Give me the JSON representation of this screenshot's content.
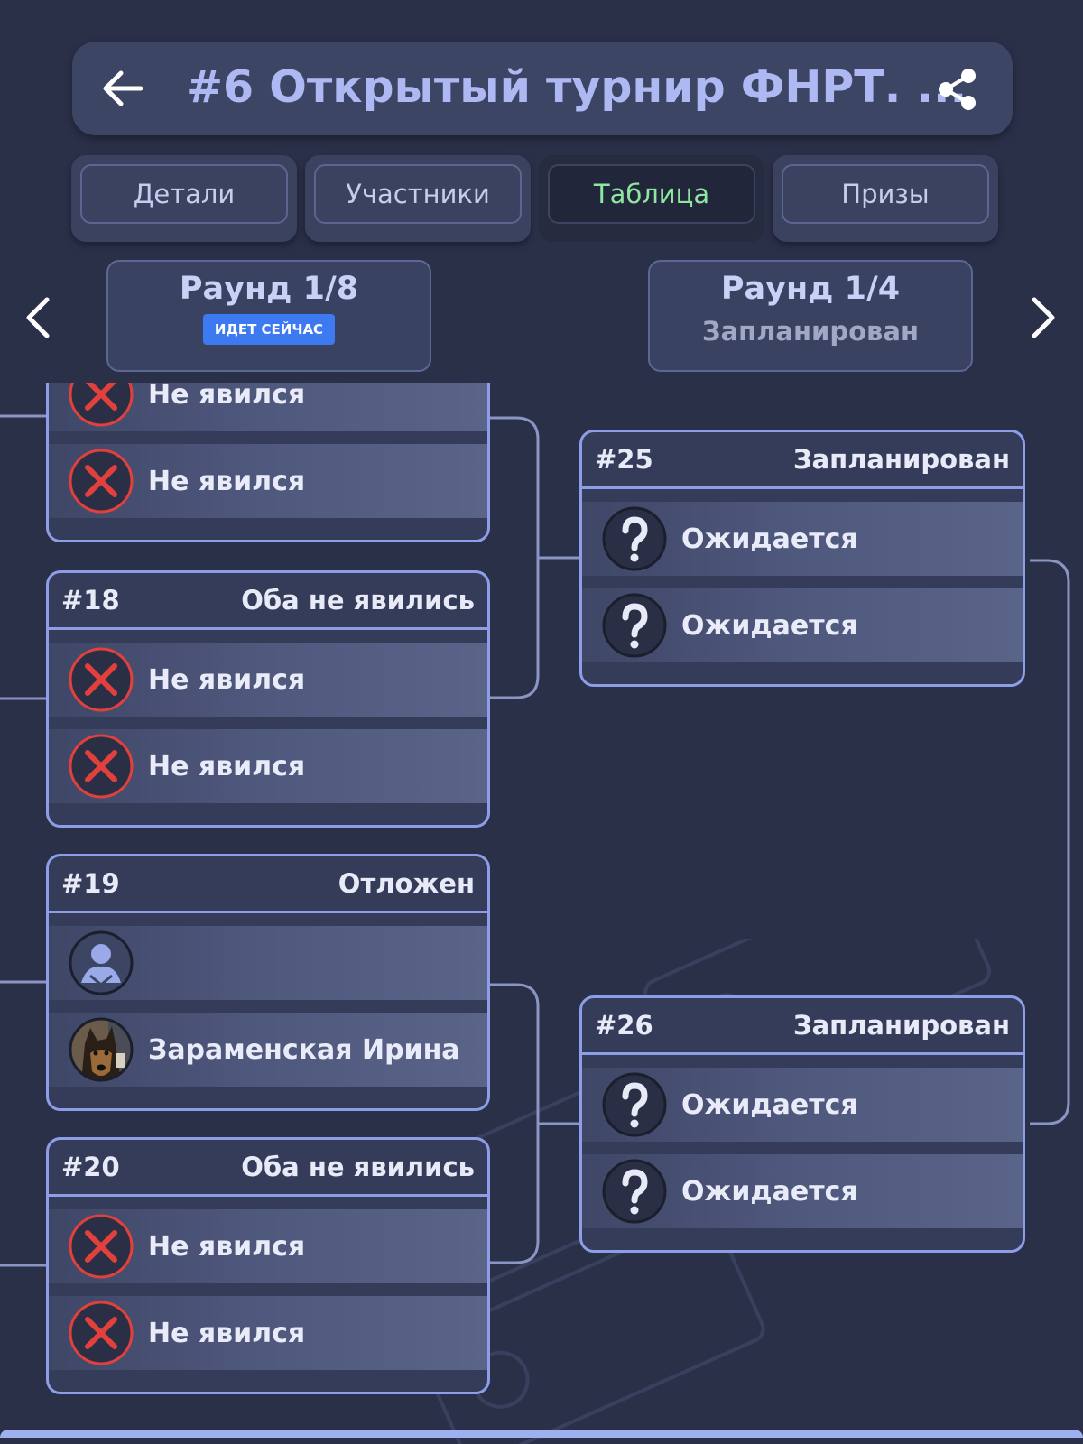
{
  "header": {
    "title": "#6 Открытый турнир ФНРТ. ...",
    "back_icon": "arrow-left-icon",
    "share_icon": "share-icon"
  },
  "tabs": [
    {
      "label": "Детали"
    },
    {
      "label": "Участники"
    },
    {
      "label": "Таблица",
      "active": true
    },
    {
      "label": "Призы"
    }
  ],
  "rounds": {
    "left": {
      "title": "Раунд 1/8",
      "badge": "ИДЕТ СЕЙЧАС"
    },
    "right": {
      "title": "Раунд 1/4",
      "status": "Запланирован"
    }
  },
  "colors": {
    "background": "#2b3049",
    "accent_border": "#8e9de8",
    "active_tab_text": "#8fe6a0",
    "badge": "#3d7af2",
    "no_show_icon": "#e2403c"
  },
  "matches": {
    "m17": {
      "players": [
        {
          "name": "Не явился",
          "icon": "no-show-icon"
        },
        {
          "name": "Не явился",
          "icon": "no-show-icon"
        }
      ]
    },
    "m18": {
      "number": "#18",
      "status": "Оба не явились",
      "players": [
        {
          "name": "Не явился",
          "icon": "no-show-icon"
        },
        {
          "name": "Не явился",
          "icon": "no-show-icon"
        }
      ]
    },
    "m19": {
      "number": "#19",
      "status": "Отложен",
      "players": [
        {
          "name": "",
          "icon": "default-avatar-icon"
        },
        {
          "name": "Зараменская Ирина",
          "icon": "dog-photo-avatar"
        }
      ]
    },
    "m20": {
      "number": "#20",
      "status": "Оба не явились",
      "players": [
        {
          "name": "Не явился",
          "icon": "no-show-icon"
        },
        {
          "name": "Не явился",
          "icon": "no-show-icon"
        }
      ]
    },
    "m25": {
      "number": "#25",
      "status": "Запланирован",
      "players": [
        {
          "name": "Ожидается",
          "icon": "question-icon"
        },
        {
          "name": "Ожидается",
          "icon": "question-icon"
        }
      ]
    },
    "m26": {
      "number": "#26",
      "status": "Запланирован",
      "players": [
        {
          "name": "Ожидается",
          "icon": "question-icon"
        },
        {
          "name": "Ожидается",
          "icon": "question-icon"
        }
      ]
    }
  }
}
